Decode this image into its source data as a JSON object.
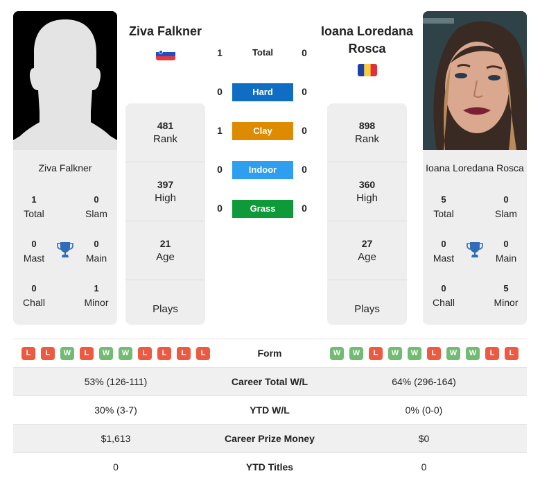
{
  "player1": {
    "name": "Ziva Falkner",
    "flag": "slovenia-flag",
    "photo": "silhouette-placeholder",
    "titles": {
      "total": {
        "value": "1",
        "label": "Total"
      },
      "slam": {
        "value": "0",
        "label": "Slam"
      },
      "mast": {
        "value": "0",
        "label": "Mast"
      },
      "main": {
        "value": "0",
        "label": "Main"
      },
      "chall": {
        "value": "0",
        "label": "Chall"
      },
      "minor": {
        "value": "1",
        "label": "Minor"
      }
    },
    "rank": {
      "value": "481",
      "label": "Rank"
    },
    "high": {
      "value": "397",
      "label": "High"
    },
    "age": {
      "value": "21",
      "label": "Age"
    },
    "plays": {
      "label": "Plays"
    }
  },
  "player2": {
    "name": "Ioana Loredana Rosca",
    "flag": "romania-flag",
    "photo": "player-photo",
    "titles": {
      "total": {
        "value": "5",
        "label": "Total"
      },
      "slam": {
        "value": "0",
        "label": "Slam"
      },
      "mast": {
        "value": "0",
        "label": "Mast"
      },
      "main": {
        "value": "0",
        "label": "Main"
      },
      "chall": {
        "value": "0",
        "label": "Chall"
      },
      "minor": {
        "value": "5",
        "label": "Minor"
      }
    },
    "rank": {
      "value": "898",
      "label": "Rank"
    },
    "high": {
      "value": "360",
      "label": "High"
    },
    "age": {
      "value": "27",
      "label": "Age"
    },
    "plays": {
      "label": "Plays"
    }
  },
  "h2h": {
    "total": {
      "label": "Total",
      "p1": "1",
      "p2": "0"
    },
    "surfaces": [
      {
        "label": "Hard",
        "p1": "0",
        "p2": "0",
        "color": "#0f6dc4"
      },
      {
        "label": "Clay",
        "p1": "1",
        "p2": "0",
        "color": "#dd8b00"
      },
      {
        "label": "Indoor",
        "p1": "0",
        "p2": "0",
        "color": "#2d9ef0"
      },
      {
        "label": "Grass",
        "p1": "0",
        "p2": "0",
        "color": "#0f9a3a"
      }
    ]
  },
  "comparison": {
    "form": {
      "label": "Form",
      "p1": [
        "L",
        "L",
        "W",
        "L",
        "W",
        "W",
        "L",
        "L",
        "L",
        "L"
      ],
      "p2": [
        "W",
        "W",
        "L",
        "W",
        "W",
        "L",
        "W",
        "W",
        "L",
        "L"
      ]
    },
    "rows": [
      {
        "label": "Career Total W/L",
        "p1": "53% (126-111)",
        "p2": "64% (296-164)"
      },
      {
        "label": "YTD W/L",
        "p1": "30% (3-7)",
        "p2": "0% (0-0)"
      },
      {
        "label": "Career Prize Money",
        "p1": "$1,613",
        "p2": "$0"
      },
      {
        "label": "YTD Titles",
        "p1": "0",
        "p2": "0"
      }
    ]
  },
  "colors": {
    "win": "#72bb72",
    "loss": "#ee5a41",
    "trophy": "#2f6db8",
    "card_bg": "#eeeeee"
  }
}
